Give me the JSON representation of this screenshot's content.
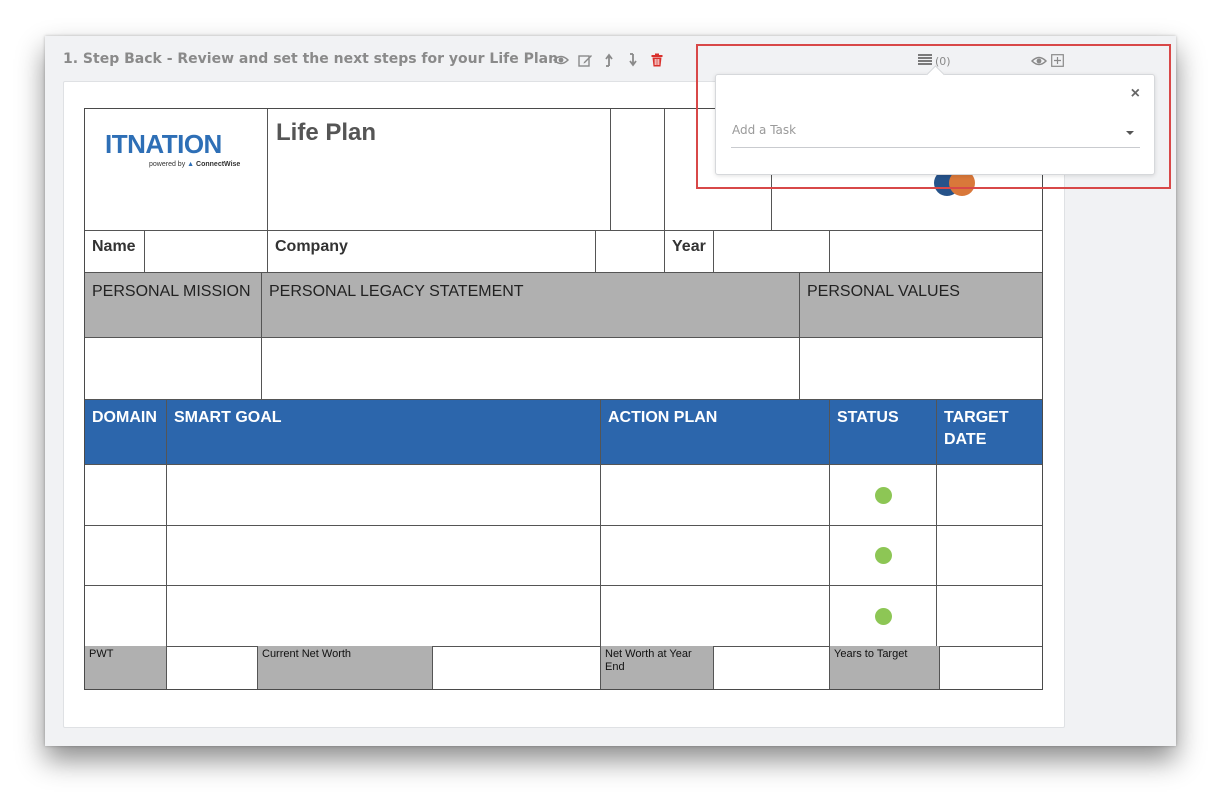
{
  "section": {
    "title": "1. Step Back - Review and set the next steps for your Life Plan",
    "icons": [
      "eye-icon",
      "edit-icon",
      "move-up-icon",
      "move-down-icon",
      "trash-icon"
    ]
  },
  "task_bar": {
    "count_label": "(0)"
  },
  "task_popover": {
    "close_label": "×",
    "placeholder": "Add a Task"
  },
  "life_plan": {
    "logo": {
      "brand": "ITNATION",
      "tagline_prefix": "powered by",
      "tagline_brand": "ConnectWise"
    },
    "title": "Life Plan",
    "labels": {
      "name": "Name",
      "company": "Company",
      "year": "Year"
    },
    "personal_headers": {
      "mission": "PERSONAL MISSION",
      "legacy": "PERSONAL LEGACY STATEMENT",
      "values": "PERSONAL VALUES"
    },
    "goal_headers": {
      "domain": "DOMAIN",
      "smart_goal": "SMART GOAL",
      "action_plan": "ACTION PLAN",
      "status": "STATUS",
      "target_date": "TARGET DATE"
    },
    "goal_rows": [
      {
        "status_color": "#8dc655"
      },
      {
        "status_color": "#8dc655"
      },
      {
        "status_color": "#8dc655"
      }
    ],
    "footer": {
      "pwt": "PWT",
      "current_net_worth": "Current Net Worth",
      "net_worth_year_end": "Net Worth at Year End",
      "years_to_target": "Years to Target"
    },
    "colors": {
      "header_blue": "#2c66ac",
      "header_gray": "#b0b0b0",
      "status_green": "#8dc655"
    }
  }
}
